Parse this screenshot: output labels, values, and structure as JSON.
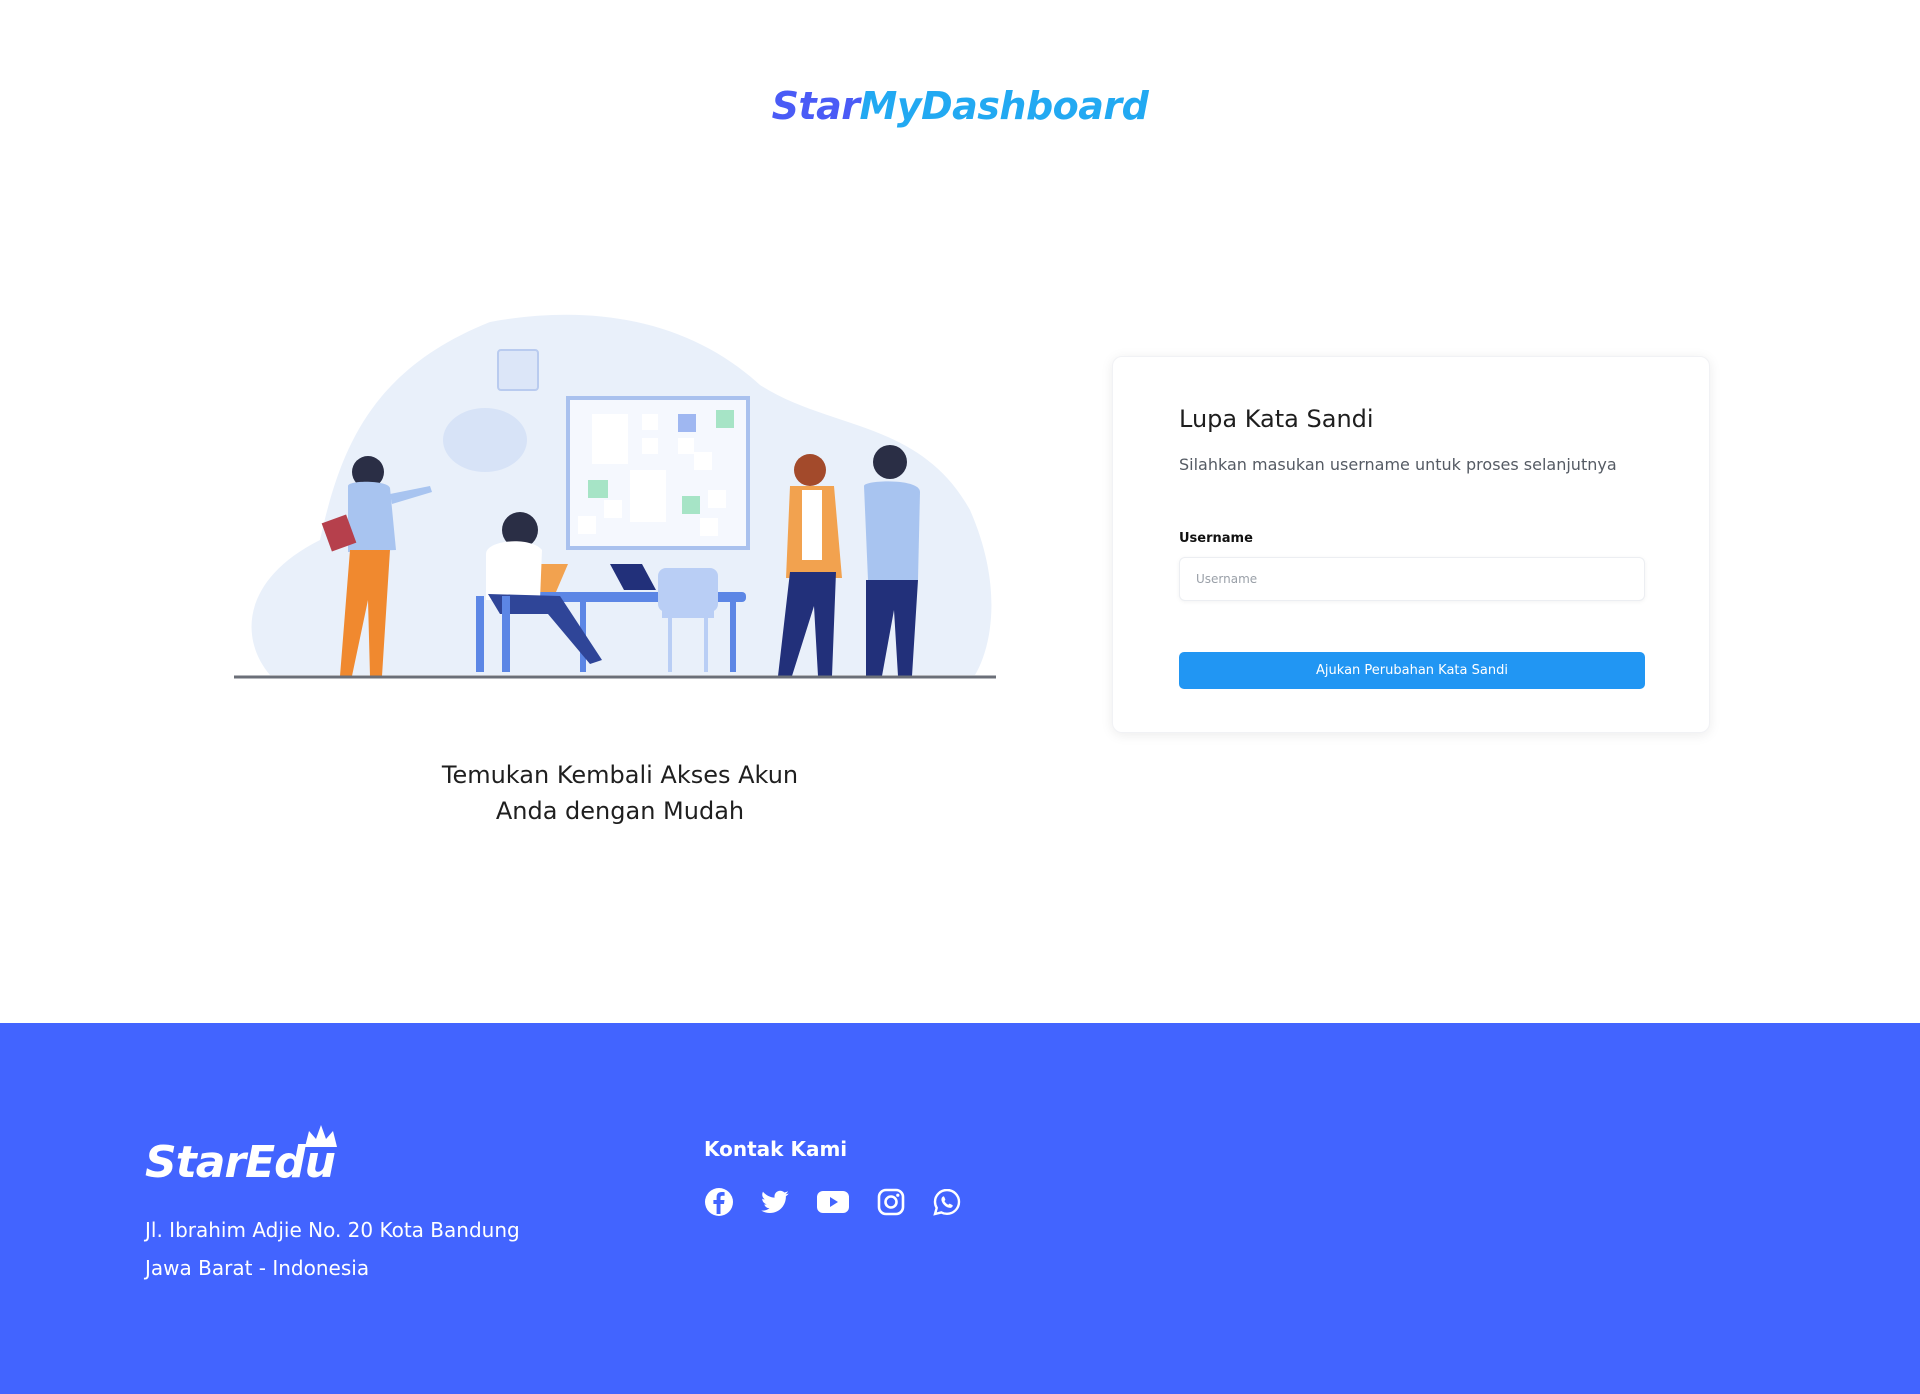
{
  "header": {
    "logo_part1": "Star",
    "logo_part2": "MyDashboard"
  },
  "hero": {
    "tagline_line1": "Temukan Kembali Akses Akun",
    "tagline_line2": "Anda dengan Mudah"
  },
  "form": {
    "title": "Lupa Kata Sandi",
    "subtitle": "Silahkan masukan username untuk proses selanjutnya",
    "username_label": "Username",
    "username_placeholder": "Username",
    "username_value": "",
    "submit_label": "Ajukan Perubahan Kata Sandi"
  },
  "footer": {
    "logo": "StarEdu",
    "address_line1": "Jl. Ibrahim Adjie No. 20 Kota Bandung",
    "address_line2": "Jawa Barat - Indonesia",
    "contact_title": "Kontak Kami",
    "socials": [
      "facebook-icon",
      "twitter-icon",
      "youtube-icon",
      "instagram-icon",
      "whatsapp-icon"
    ]
  },
  "colors": {
    "brand_blue": "#4A5BF6",
    "brand_light_blue": "#22A9F2",
    "button": "#2196F3",
    "footer_bg": "#4264FF"
  }
}
